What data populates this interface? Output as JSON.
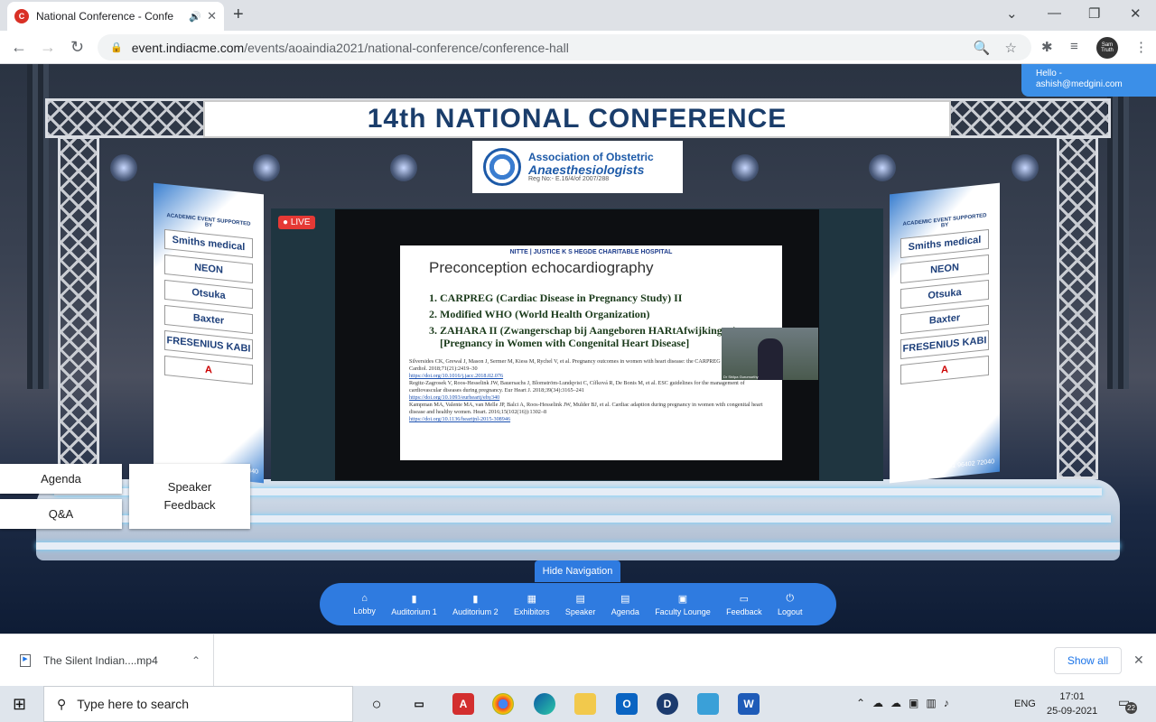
{
  "browser": {
    "tab_title": "National Conference - Confe",
    "tab_favicon": "C",
    "url_prefix": "event.indiacme.com",
    "url_path": "/events/aoaindia2021/national-conference/conference-hall",
    "profile_label": "Sam Truth"
  },
  "user": {
    "greeting": "Hello -",
    "email": "ashish@medgini.com"
  },
  "stage": {
    "banner": "14th NATIONAL CONFERENCE",
    "logo_line1": "Association of Obstetric",
    "logo_line2": "Anaesthesiologists",
    "logo_line3": "Reg No:- E.16/4/of 2007/288",
    "live_label": "LIVE"
  },
  "boards": {
    "left": [
      "Smiths medical",
      "NEON",
      "Otsuka",
      "Baxter",
      "FRESENIUS KABI",
      "A"
    ],
    "right": [
      "Smiths medical",
      "NEON",
      "Otsuka",
      "Baxter",
      "FRESENIUS KABI",
      "A"
    ],
    "academic": "ACADEMIC EVENT SUPPORTED BY",
    "phone": "+91 96402 72040",
    "phone_short": "2040"
  },
  "slide": {
    "header": "NITTE | JUSTICE K S HEGDE CHARITABLE HOSPITAL",
    "title": "Preconception echocardiography",
    "items": [
      "CARPREG (Cardiac Disease in Pregnancy Study) II",
      "Modified WHO (World Health Organization)",
      "ZAHARA II (Zwangerschap bij Aangeboren HARtAfwijkingen) [Pregnancy in Women with Congenital Heart Disease]"
    ],
    "refs": [
      {
        "text": "Silversides CK, Grewal J, Mason J, Sermer M, Kiess M, Rychel V, et al. Pregnancy outcomes in women with heart disease: the CARPREG II Study. J Am Coll Cardiol. 2018;71(21):2419–30",
        "link": "https://doi.org/10.1016/j.jacc.2018.02.076"
      },
      {
        "text": "Regitz-Zagrosek V, Roos-Hesselink JW, Bauersachs J, Blomström-Lundqvist C, Cífková R, De Bonis M, et al. ESC guidelines for the management of cardiovascular diseases during pregnancy. Eur Heart J. 2018;39(34):3165–241",
        "link": "https://doi.org/10.1093/eurheartj/ehy340"
      },
      {
        "text": "Kampman MA, Valente MA, van Melle JP, Balci A, Roos-Hesselink JW, Mulder BJ, et al. Cardiac adaption during pregnancy in women with congenital heart disease and healthy women. Heart. 2016;15(102(16)):1302–8",
        "link": "https://doi.org/10.1136/heartjnl-2015-308946"
      }
    ],
    "cam_name": "Dr Shilpa Gurumurthy"
  },
  "side_nav": {
    "agenda": "Agenda",
    "qa": "Q&A",
    "speaker_feedback": "Speaker Feedback"
  },
  "bottom_nav": {
    "hide": "Hide Navigation",
    "items": [
      "Lobby",
      "Auditorium 1",
      "Auditorium 2",
      "Exhibitors",
      "Speaker",
      "Agenda",
      "Faculty Lounge",
      "Feedback",
      "Logout"
    ]
  },
  "download": {
    "file": "The Silent Indian....mp4",
    "show_all": "Show all"
  },
  "taskbar": {
    "search_placeholder": "Type here to search",
    "lang": "ENG",
    "time": "17:01",
    "date": "25-09-2021",
    "notifications": "22"
  }
}
